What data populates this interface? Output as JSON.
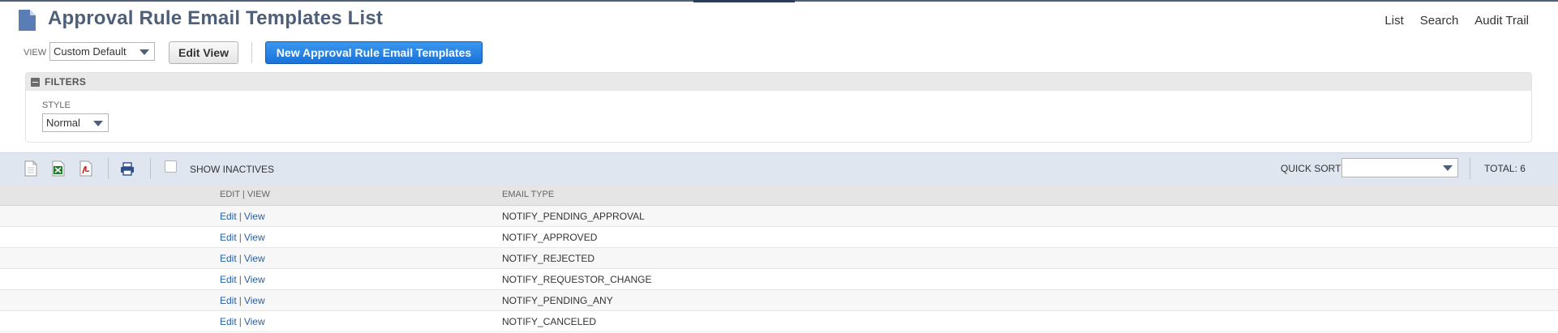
{
  "title": "Approval Rule Email Templates List",
  "top_links": [
    "List",
    "Search",
    "Audit Trail"
  ],
  "view": {
    "label": "VIEW",
    "selected": "Custom Default",
    "edit_button": "Edit View",
    "new_button": "New Approval Rule Email Templates"
  },
  "filters": {
    "title": "FILTERS",
    "style_label": "STYLE",
    "style_value": "Normal"
  },
  "toolbar": {
    "show_inactives": "SHOW INACTIVES",
    "show_inactives_checked": false,
    "quick_sort_label": "QUICK SORT",
    "quick_sort_value": "",
    "total": "TOTAL: 6"
  },
  "table": {
    "columns": [
      "EDIT | VIEW",
      "EMAIL TYPE"
    ],
    "edit_label": "Edit",
    "view_label": "View",
    "rows": [
      {
        "email_type": "NOTIFY_PENDING_APPROVAL"
      },
      {
        "email_type": "NOTIFY_APPROVED"
      },
      {
        "email_type": "NOTIFY_REJECTED"
      },
      {
        "email_type": "NOTIFY_REQUESTOR_CHANGE"
      },
      {
        "email_type": "NOTIFY_PENDING_ANY"
      },
      {
        "email_type": "NOTIFY_CANCELED"
      }
    ]
  },
  "colors": {
    "title": "#4d5f79",
    "primary_button": "#1a73d9",
    "link": "#255fa5",
    "toolbar_bg": "#e0e6ef"
  },
  "icons": [
    "document-icon",
    "csv-export-icon",
    "excel-export-icon",
    "pdf-export-icon",
    "print-icon",
    "collapse-icon",
    "dropdown-arrow-icon"
  ]
}
